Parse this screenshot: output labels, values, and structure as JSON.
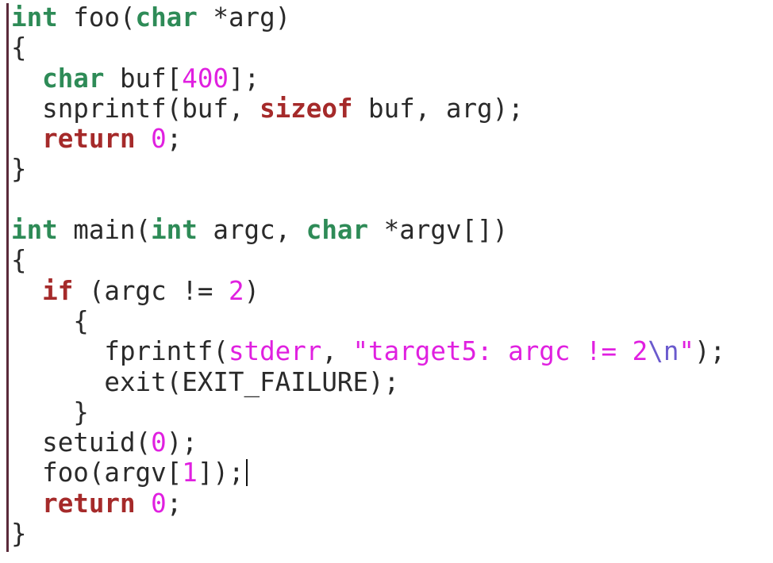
{
  "colors": {
    "type": "#2e8b57",
    "keyword": "#a52a2a",
    "number": "#e020e0",
    "string": "#e020e0",
    "special_char": "#6a5acd",
    "text": "#2a2a2a"
  },
  "code_lines": [
    [
      {
        "t": "type",
        "v": "int"
      },
      {
        "t": "plain",
        "v": " foo("
      },
      {
        "t": "type",
        "v": "char"
      },
      {
        "t": "plain",
        "v": " *arg)"
      }
    ],
    [
      {
        "t": "plain",
        "v": "{"
      }
    ],
    [
      {
        "t": "plain",
        "v": "  "
      },
      {
        "t": "type",
        "v": "char"
      },
      {
        "t": "plain",
        "v": " buf["
      },
      {
        "t": "num",
        "v": "400"
      },
      {
        "t": "plain",
        "v": "];"
      }
    ],
    [
      {
        "t": "plain",
        "v": "  snprintf(buf, "
      },
      {
        "t": "kw",
        "v": "sizeof"
      },
      {
        "t": "plain",
        "v": " buf, arg);"
      }
    ],
    [
      {
        "t": "plain",
        "v": "  "
      },
      {
        "t": "kw",
        "v": "return"
      },
      {
        "t": "plain",
        "v": " "
      },
      {
        "t": "num",
        "v": "0"
      },
      {
        "t": "plain",
        "v": ";"
      }
    ],
    [
      {
        "t": "plain",
        "v": "}"
      }
    ],
    [],
    [
      {
        "t": "type",
        "v": "int"
      },
      {
        "t": "plain",
        "v": " main("
      },
      {
        "t": "type",
        "v": "int"
      },
      {
        "t": "plain",
        "v": " argc, "
      },
      {
        "t": "type",
        "v": "char"
      },
      {
        "t": "plain",
        "v": " *argv[])"
      }
    ],
    [
      {
        "t": "plain",
        "v": "{"
      }
    ],
    [
      {
        "t": "plain",
        "v": "  "
      },
      {
        "t": "kw",
        "v": "if"
      },
      {
        "t": "plain",
        "v": " (argc != "
      },
      {
        "t": "num",
        "v": "2"
      },
      {
        "t": "plain",
        "v": ")"
      }
    ],
    [
      {
        "t": "plain",
        "v": "    {"
      }
    ],
    [
      {
        "t": "plain",
        "v": "      fprintf("
      },
      {
        "t": "str",
        "v": "stderr"
      },
      {
        "t": "plain",
        "v": ", "
      },
      {
        "t": "str",
        "v": "\"target5: argc != 2"
      },
      {
        "t": "special",
        "v": "\\n"
      },
      {
        "t": "str",
        "v": "\""
      },
      {
        "t": "plain",
        "v": ");"
      }
    ],
    [
      {
        "t": "plain",
        "v": "      exit(EXIT_FAILURE);"
      }
    ],
    [
      {
        "t": "plain",
        "v": "    }"
      }
    ],
    [
      {
        "t": "plain",
        "v": "  setuid("
      },
      {
        "t": "num",
        "v": "0"
      },
      {
        "t": "plain",
        "v": ");"
      }
    ],
    [
      {
        "t": "plain",
        "v": "  foo(argv["
      },
      {
        "t": "num",
        "v": "1"
      },
      {
        "t": "plain",
        "v": "]);"
      },
      {
        "t": "cursor",
        "v": ""
      }
    ],
    [
      {
        "t": "plain",
        "v": "  "
      },
      {
        "t": "kw",
        "v": "return"
      },
      {
        "t": "plain",
        "v": " "
      },
      {
        "t": "num",
        "v": "0"
      },
      {
        "t": "plain",
        "v": ";"
      }
    ],
    [
      {
        "t": "plain",
        "v": "}"
      }
    ]
  ]
}
